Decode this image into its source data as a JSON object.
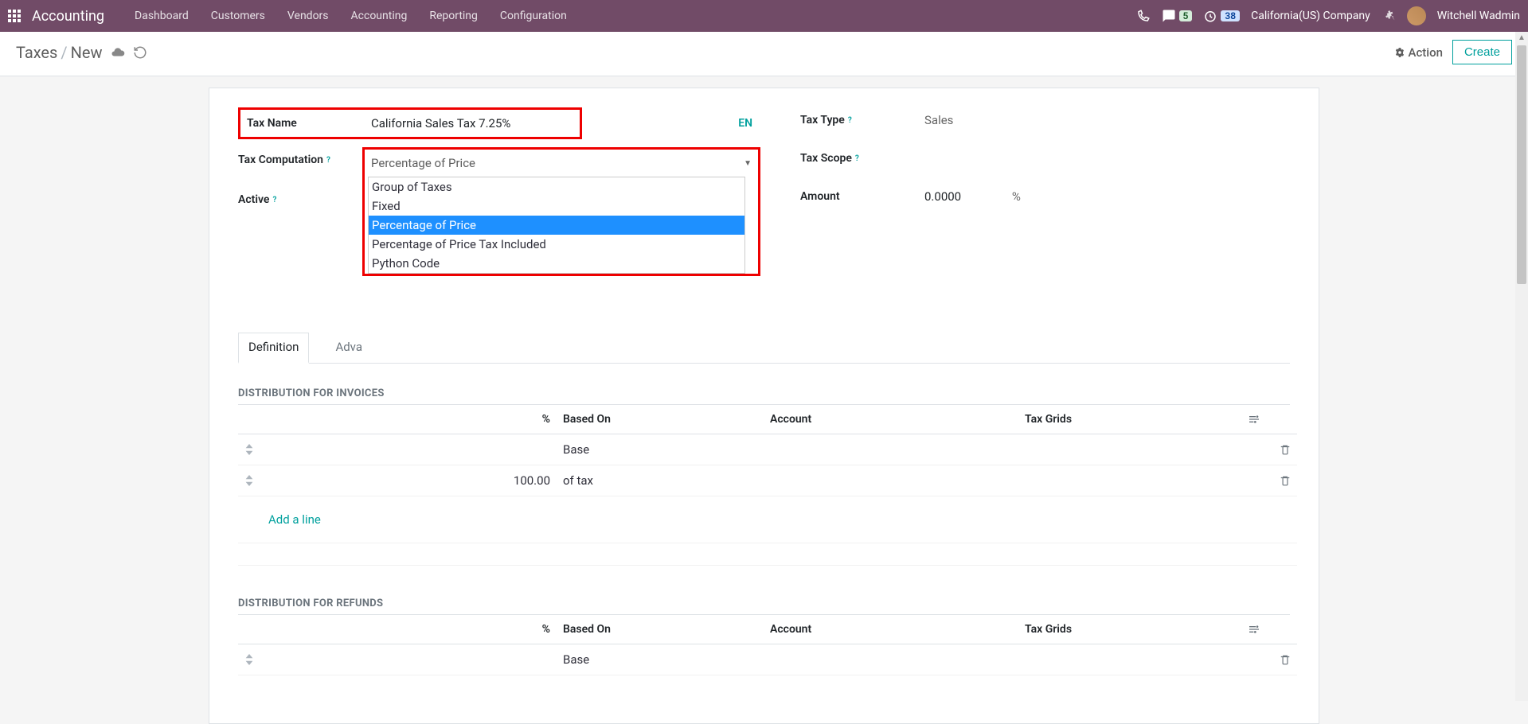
{
  "navbar": {
    "brand": "Accounting",
    "menu": [
      "Dashboard",
      "Customers",
      "Vendors",
      "Accounting",
      "Reporting",
      "Configuration"
    ],
    "msg_count": "5",
    "timer_count": "38",
    "company": "California(US) Company",
    "user": "Witchell Wadmin"
  },
  "breadcrumb": {
    "root": "Taxes",
    "current": "New"
  },
  "cp": {
    "action_label": "Action",
    "create_label": "Create"
  },
  "form": {
    "tax_name_label": "Tax Name",
    "tax_name_value": "California Sales Tax 7.25%",
    "en_label": "EN",
    "tax_type_label": "Tax Type",
    "tax_type_value": "Sales",
    "tax_comp_label": "Tax Computation",
    "tax_comp_value": "Percentage of Price",
    "tax_scope_label": "Tax Scope",
    "active_label": "Active",
    "amount_label": "Amount",
    "amount_value": "0.0000",
    "amount_suffix": "%",
    "dropdown_options": [
      "Group of Taxes",
      "Fixed",
      "Percentage of Price",
      "Percentage of Price Tax Included",
      "Python Code"
    ],
    "dropdown_selected": "Percentage of Price"
  },
  "tabs": {
    "definition": "Definition",
    "advanced": "Adva"
  },
  "section1_title": "DISTRIBUTION FOR INVOICES",
  "section2_title": "DISTRIBUTION FOR REFUNDS",
  "cols": {
    "percent": "%",
    "based_on": "Based On",
    "account": "Account",
    "tax_grids": "Tax Grids"
  },
  "invoice_rows": [
    {
      "pct": "",
      "based_on": "Base"
    },
    {
      "pct": "100.00",
      "based_on": "of tax"
    }
  ],
  "refund_rows": [
    {
      "pct": "",
      "based_on": "Base"
    }
  ],
  "add_line": "Add a line"
}
